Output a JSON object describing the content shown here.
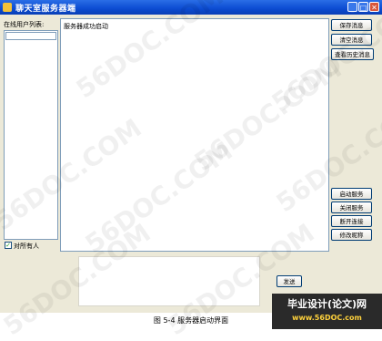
{
  "window": {
    "title": "聊天室服务器端",
    "controls": {
      "minimize": "_",
      "maximize": "□",
      "close": "✕"
    }
  },
  "left_panel": {
    "label": "在线用户列表:",
    "checkbox_label": "对所有人",
    "checkbox_checked": true
  },
  "message_area": {
    "lines": [
      "服务器成功启动"
    ]
  },
  "right_buttons_top": [
    "保存消息",
    "清空消息",
    "查看历史消息"
  ],
  "right_buttons_bottom": [
    "启动服务",
    "关闭服务",
    "断开连接",
    "修改昵称"
  ],
  "send_button": "发送",
  "caption": "图 5-4 服务器启动界面",
  "badge": {
    "top": "毕业设计(论文)网",
    "bottom": "www.56DOC.com"
  },
  "watermarks": [
    "56DOC.COM",
    "56DOC.COM",
    "56DOC.COM",
    "56DOC.COM",
    "56DOC.COM",
    "56DOC.COM",
    "56DOC.COM",
    "56DOC.COM"
  ]
}
